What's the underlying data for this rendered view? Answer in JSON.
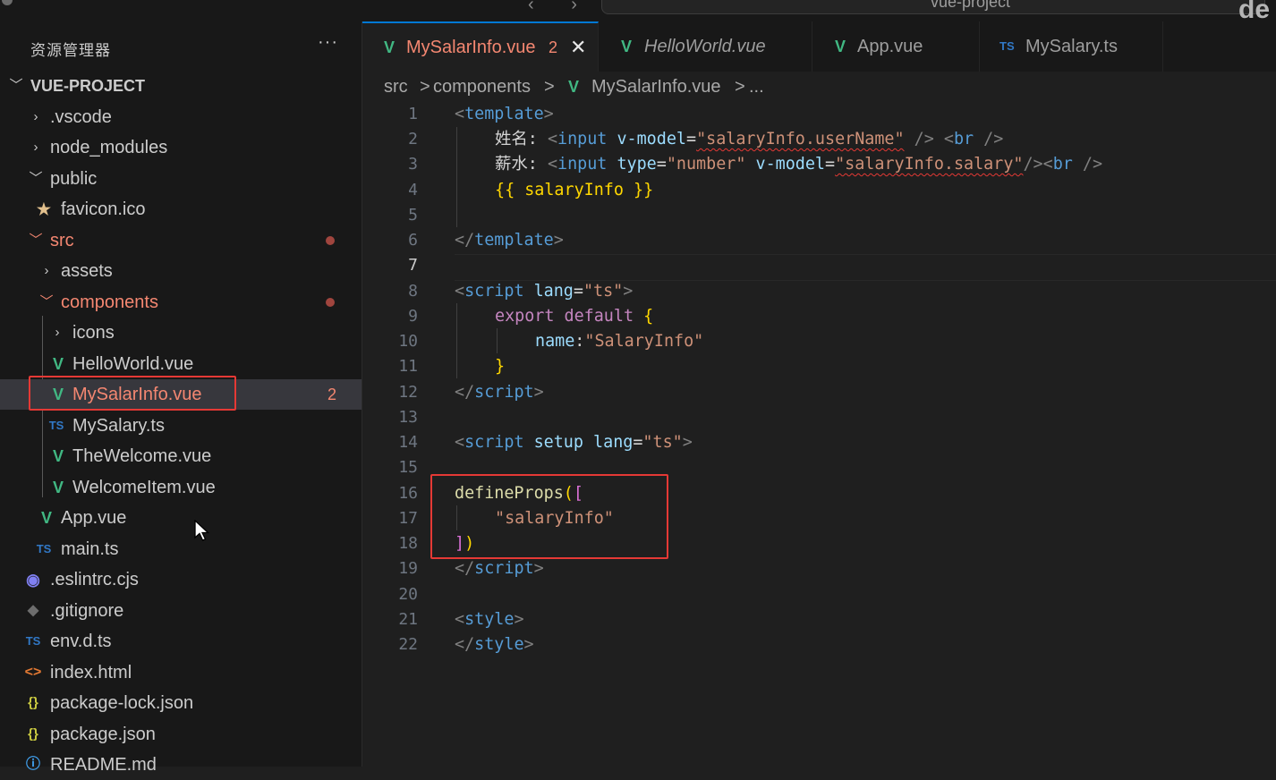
{
  "topbar": {
    "nav_arrows": "‹ ›",
    "command_center_text": "vue-project",
    "corner_text": "de"
  },
  "explorer": {
    "title": "资源管理器",
    "more_actions": "···",
    "project_name": "VUE-PROJECT",
    "items": [
      {
        "label": ".vscode",
        "icon": "chevron-right-icon"
      },
      {
        "label": "node_modules",
        "icon": "chevron-right-icon"
      },
      {
        "label": "public",
        "icon": "chevron-down-icon"
      },
      {
        "label": "favicon.ico",
        "icon": "star-icon"
      },
      {
        "label": "src",
        "icon": "chevron-down-icon",
        "status": "modified"
      },
      {
        "label": "assets",
        "icon": "chevron-right-icon"
      },
      {
        "label": "components",
        "icon": "chevron-down-icon",
        "status": "modified"
      },
      {
        "label": "icons",
        "icon": "chevron-right-icon"
      },
      {
        "label": "HelloWorld.vue",
        "icon": "vue-icon"
      },
      {
        "label": "MySalarInfo.vue",
        "icon": "vue-icon",
        "badge": "2",
        "selected": true
      },
      {
        "label": "MySalary.ts",
        "icon": "ts-icon"
      },
      {
        "label": "TheWelcome.vue",
        "icon": "vue-icon"
      },
      {
        "label": "WelcomeItem.vue",
        "icon": "vue-icon"
      },
      {
        "label": "App.vue",
        "icon": "vue-icon"
      },
      {
        "label": "main.ts",
        "icon": "ts-icon"
      },
      {
        "label": ".eslintrc.cjs",
        "icon": "eslint-icon"
      },
      {
        "label": ".gitignore",
        "icon": "git-icon"
      },
      {
        "label": "env.d.ts",
        "icon": "ts-icon"
      },
      {
        "label": "index.html",
        "icon": "html-icon"
      },
      {
        "label": "package-lock.json",
        "icon": "json-icon"
      },
      {
        "label": "package.json",
        "icon": "json-icon"
      },
      {
        "label": "README.md",
        "icon": "info-icon"
      }
    ],
    "icon_glyphs": {
      "vue": "V",
      "ts": "TS",
      "star": "★",
      "json": "{}",
      "html": "<>",
      "info": "ⓘ"
    }
  },
  "tabs": [
    {
      "label": "MySalarInfo.vue",
      "problems": "2",
      "close": "✕",
      "active": true,
      "icon": "vue-icon"
    },
    {
      "label": "HelloWorld.vue",
      "icon": "vue-icon",
      "preview": true
    },
    {
      "label": "App.vue",
      "icon": "vue-icon"
    },
    {
      "label": "MySalary.ts",
      "icon": "ts-icon"
    }
  ],
  "breadcrumb": {
    "parts": [
      "src",
      "components",
      "MySalarInfo.vue",
      "..."
    ],
    "separator": ">"
  },
  "editor": {
    "line_numbers": [
      "1",
      "2",
      "3",
      "4",
      "5",
      "6",
      "7",
      "8",
      "9",
      "10",
      "11",
      "12",
      "13",
      "14",
      "15",
      "16",
      "17",
      "18",
      "19",
      "20",
      "21",
      "22"
    ],
    "active_line": "7",
    "tokens": {
      "template_open": "template",
      "label_name": "姓名:",
      "label_salary": "薪水:",
      "input": "input",
      "vmodel": "v-model",
      "type_attr": "type",
      "number": "\"number\"",
      "username_expr": "\"salaryInfo.userName\"",
      "salary_expr": "\"salaryInfo.salary\"",
      "br": "br",
      "interp": "{{ salaryInfo }}",
      "script": "script",
      "lang": "lang",
      "ts": "\"ts\"",
      "export": "export",
      "default": "default",
      "name_key": "name",
      "salary_info_name": "\"SalaryInfo\"",
      "setup": "setup",
      "define_props": "defineProps",
      "props_item": "\"salaryInfo\"",
      "style": "style"
    }
  },
  "colors": {
    "accent": "#0078d4",
    "error": "#f48771",
    "vue_green": "#41b883",
    "ts_blue": "#3178c6",
    "highlight_red": "#e53935"
  }
}
